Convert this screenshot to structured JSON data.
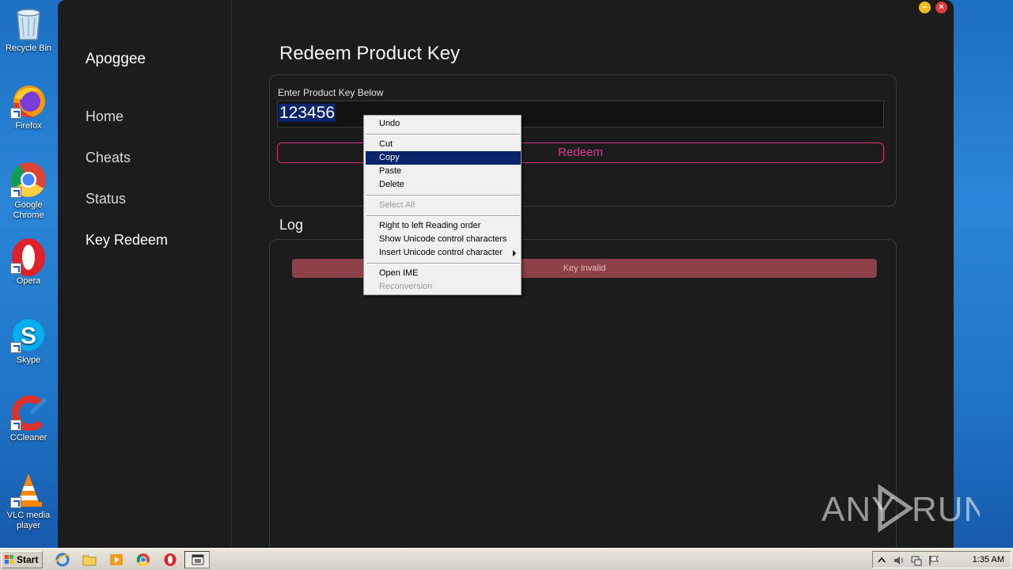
{
  "desktop": {
    "icons": [
      {
        "label": "Recycle Bin",
        "icon": "recycle-bin-icon"
      },
      {
        "label": "Firefox",
        "icon": "firefox-icon"
      },
      {
        "label": "Google Chrome",
        "icon": "chrome-icon"
      },
      {
        "label": "Opera",
        "icon": "opera-icon"
      },
      {
        "label": "Skype",
        "icon": "skype-icon"
      },
      {
        "label": "CCleaner",
        "icon": "ccleaner-icon"
      },
      {
        "label": "VLC media player",
        "icon": "vlc-icon"
      }
    ]
  },
  "app": {
    "brand": "Apoggee",
    "nav": [
      {
        "label": "Home"
      },
      {
        "label": "Cheats"
      },
      {
        "label": "Status"
      },
      {
        "label": "Key Redeem",
        "active": true
      }
    ],
    "window_controls": {
      "minimize": "–",
      "close": "×"
    },
    "redeem": {
      "title": "Redeem Product Key",
      "input_label": "Enter Product Key Below",
      "input_value": "123456",
      "button_label": "Redeem"
    },
    "log": {
      "title": "Log",
      "entries": [
        "Key Invalid"
      ]
    }
  },
  "context_menu": {
    "items": [
      "Undo",
      "Cut",
      "Copy",
      "Paste",
      "Delete",
      "Select All",
      "Right to left Reading order",
      "Show Unicode control characters",
      "Insert Unicode control character",
      "Open IME",
      "Reconversion"
    ],
    "highlighted": "Copy",
    "disabled": [
      "Select All",
      "Reconversion"
    ]
  },
  "watermark": "ANY RUN",
  "taskbar": {
    "start_label": "Start",
    "clock": "1:35 AM",
    "pinned": [
      "ie-icon",
      "folder-icon",
      "media-player-icon",
      "chrome-icon",
      "opera-icon",
      "app-window-icon"
    ]
  },
  "colors": {
    "app_bg": "#1c1c1c",
    "accent_pink": "#e23a8a",
    "log_error_bg": "#8c4148",
    "menu_highlight": "#0a246a"
  }
}
